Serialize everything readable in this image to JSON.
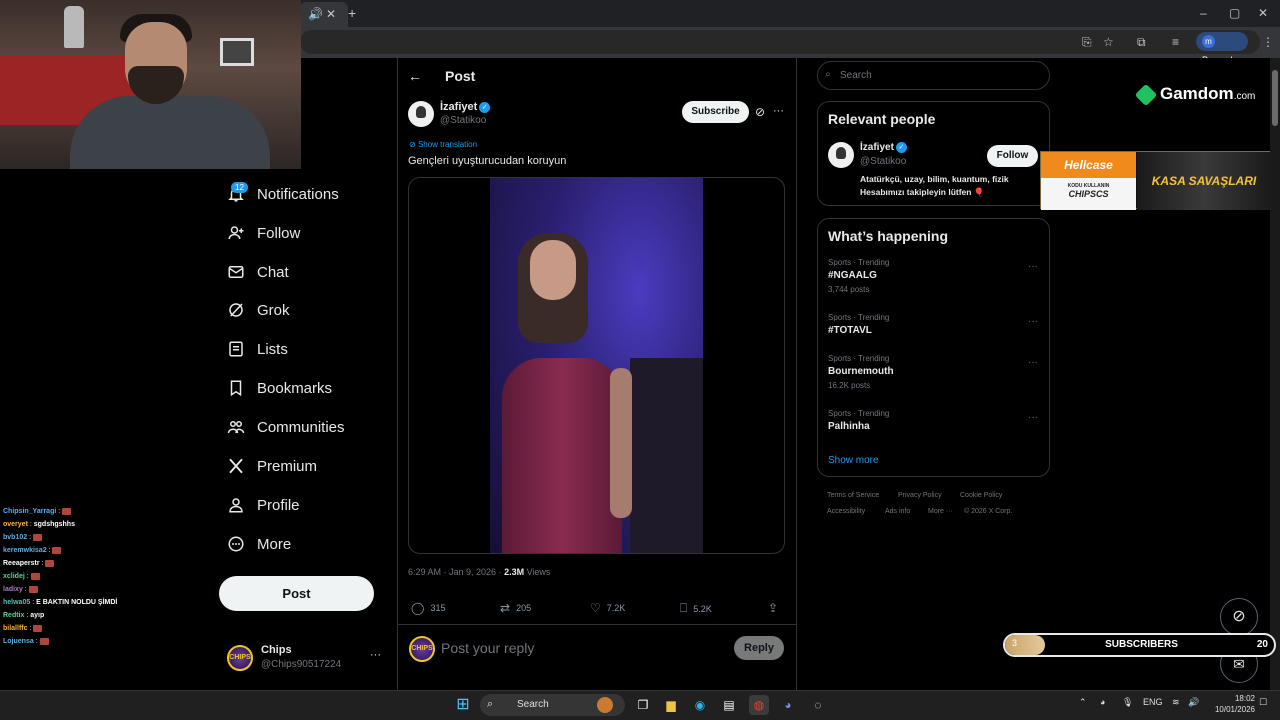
{
  "browser": {
    "profile_initial": "m",
    "profile_status": "Paused"
  },
  "nav": {
    "notifications_badge": "12",
    "items": [
      {
        "label": "Notifications",
        "icon": "bell-icon"
      },
      {
        "label": "Follow",
        "icon": "person-plus-icon"
      },
      {
        "label": "Chat",
        "icon": "envelope-icon"
      },
      {
        "label": "Grok",
        "icon": "grok-icon"
      },
      {
        "label": "Lists",
        "icon": "list-icon"
      },
      {
        "label": "Bookmarks",
        "icon": "bookmark-icon"
      },
      {
        "label": "Communities",
        "icon": "people-icon"
      },
      {
        "label": "Premium",
        "icon": "x-logo-icon"
      },
      {
        "label": "Profile",
        "icon": "person-icon"
      },
      {
        "label": "More",
        "icon": "more-circle-icon"
      }
    ],
    "post_button": "Post",
    "account": {
      "name": "Chips",
      "handle": "@Chips90517224",
      "avatar_text": "CHIPS"
    }
  },
  "chat": [
    {
      "user": "Chipsin_Yarragi",
      "color": "#4fb3ff",
      "msg": ""
    },
    {
      "user": "overyet",
      "color": "#ffb347",
      "msg": "sgdshgshhs"
    },
    {
      "user": "bvb102",
      "color": "#5dade2",
      "msg": ""
    },
    {
      "user": "keremwkisa2",
      "color": "#5dade2",
      "msg": ""
    },
    {
      "user": "Reeaperstr",
      "color": "#ffffff",
      "msg": ""
    },
    {
      "user": "xclidej",
      "color": "#58d68d",
      "msg": ""
    },
    {
      "user": "ladixy",
      "color": "#af7ac5",
      "msg": ""
    },
    {
      "user": "helwa05",
      "color": "#48c9b0",
      "msg": "E BAKTIN NOLDU ŞİMDİ"
    },
    {
      "user": "Redtix",
      "color": "#58d68d",
      "msg": "ayıp"
    },
    {
      "user": "bilallffc",
      "color": "#f5b041",
      "msg": ""
    },
    {
      "user": "Lojuensa",
      "color": "#5dade2",
      "msg": ""
    }
  ],
  "post": {
    "header_title": "Post",
    "author_name": "İzafiyet",
    "author_handle": "@Statikoo",
    "subscribe_label": "Subscribe",
    "show_translation": "Show translation",
    "text": "Gençleri uyuşturucudan koruyun",
    "timestamp": "6:29 AM · Jan 9, 2026 · ",
    "views_count": "2.3M",
    "views_label": " Views",
    "replies": "315",
    "reposts": "205",
    "likes": "7.2K",
    "bookmarks": "5.2K",
    "reply_placeholder": "Post your reply",
    "reply_button": "Reply"
  },
  "right": {
    "search_placeholder": "Search",
    "relevant_title": "Relevant people",
    "person": {
      "name": "İzafiyet",
      "handle": "@Statikoo",
      "bio": "Atatürkçü, uzay, bilim, kuantum, fizik Hesabımızı takipleyin lütfen 🎈",
      "follow_label": "Follow"
    },
    "happening_title": "What’s happening",
    "trends": [
      {
        "category": "Sports · Trending",
        "name": "#NGAALG",
        "count": "3,744 posts"
      },
      {
        "category": "Sports · Trending",
        "name": "#TOTAVL",
        "count": ""
      },
      {
        "category": "Sports · Trending",
        "name": "Bournemouth",
        "count": "16.2K posts"
      },
      {
        "category": "Sports · Trending",
        "name": "Palhinha",
        "count": ""
      }
    ],
    "show_more": "Show more",
    "footer": [
      "Terms of Service",
      "Privacy Policy",
      "Cookie Policy",
      "Accessibility",
      "Ads info",
      "More ···",
      "© 2026 X Corp."
    ]
  },
  "overlays": {
    "gamdom_name": "Gamdom",
    "gamdom_tld": ".com",
    "hellcase_brand": "Hellcase",
    "hellcase_small": "KODU KULLANIN",
    "hellcase_code": "CHIPSCS",
    "hellcase_slogan": "KASA SAVAŞLARI",
    "subscribers": {
      "current": "3",
      "label": "SUBSCRIBERS",
      "goal": "20",
      "progress": 0.15
    }
  },
  "taskbar": {
    "search": "Search",
    "lang": "ENG",
    "time": "18:02",
    "date": "10/01/2026"
  },
  "colors": {
    "accent": "#1d9bf0",
    "background": "#000000",
    "text": "#e7e9ea",
    "muted": "#71767b"
  }
}
